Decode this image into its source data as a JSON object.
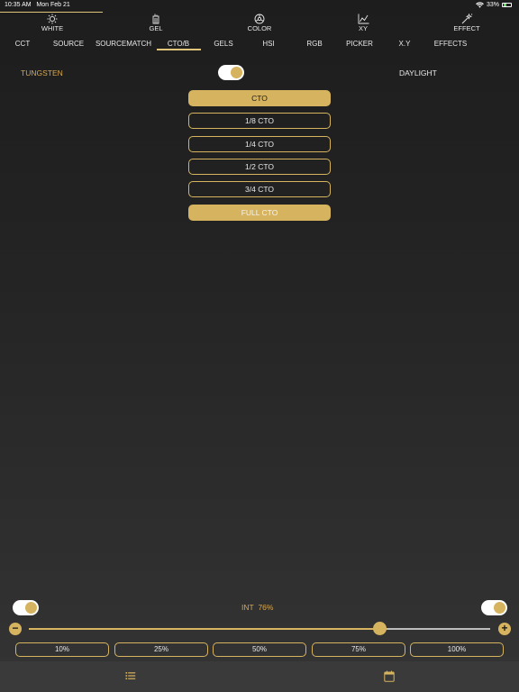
{
  "status": {
    "time": "10:35 AM",
    "date": "Mon Feb 21",
    "battery": "33%"
  },
  "topnav": [
    {
      "label": "WHITE",
      "icon": "sun-icon"
    },
    {
      "label": "GEL",
      "icon": "gel-icon"
    },
    {
      "label": "COLOR",
      "icon": "color-wheel-icon"
    },
    {
      "label": "XY",
      "icon": "xy-graph-icon"
    },
    {
      "label": "EFFECT",
      "icon": "magic-wand-icon"
    }
  ],
  "subtabs": [
    "CCT",
    "SOURCE",
    "SOURCEMATCH",
    "CTO/B",
    "GELS",
    "HSI",
    "RGB",
    "PICKER",
    "X.Y",
    "EFFECTS"
  ],
  "active_subtab": "CTO/B",
  "mode": {
    "left_label": "TUNGSTEN",
    "right_label": "DAYLIGHT"
  },
  "cto_buttons": [
    "CTO",
    "1/8 CTO",
    "1/4 CTO",
    "1/2 CTO",
    "3/4 CTO",
    "FULL CTO"
  ],
  "intensity": {
    "label": "INT",
    "value_text": "76%",
    "level": 0.76,
    "minus": "−",
    "plus": "+"
  },
  "presets": [
    "10%",
    "25%",
    "50%",
    "75%",
    "100%"
  ],
  "bottombar": {
    "left_icon": "list-icon",
    "right_icon": "calendar-icon"
  },
  "colors": {
    "accent": "#d6b35e",
    "tungsten": "#d9a84e",
    "background": "#1f1f1f"
  }
}
